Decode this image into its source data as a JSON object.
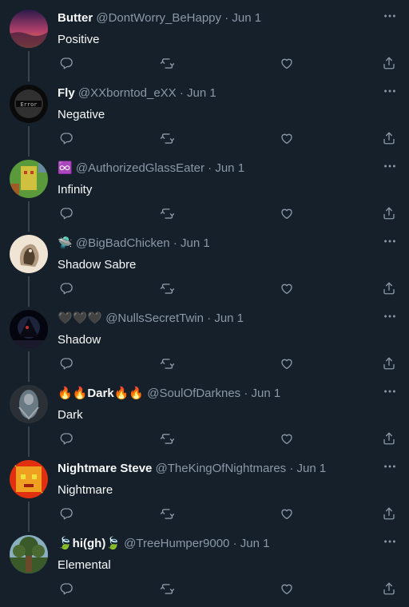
{
  "tweets": [
    {
      "name": "Butter",
      "handle": "@DontWorry_BeHappy",
      "sep": "·",
      "date": "Jun 1",
      "text": "Positive",
      "avatar": {
        "icon": "sunset-avatar",
        "colors": [
          "#2a1a4a",
          "#b0406a",
          "#f08040"
        ]
      }
    },
    {
      "name": "Fly",
      "handle": "@XXborntod_eXX",
      "sep": "·",
      "date": "Jun 1",
      "text": "Negative",
      "avatar": {
        "icon": "error-avatar",
        "colors": [
          "#0a0a0a",
          "#555555",
          "#bbbbbb"
        ]
      }
    },
    {
      "name": "♾️",
      "handle": "@AuthorizedGlassEater",
      "sep": "·",
      "date": "Jun 1",
      "text": "Infinity",
      "avatar": {
        "icon": "pixel-avatar",
        "colors": [
          "#5a9a3a",
          "#d0c040",
          "#c04020"
        ]
      }
    },
    {
      "name": "🛸",
      "handle": "@BigBadChicken",
      "sep": "·",
      "date": "Jun 1",
      "text": "Shadow Sabre",
      "avatar": {
        "icon": "chicken-avatar",
        "colors": [
          "#f0e4d4",
          "#3a2a1a",
          "#8a6a4a"
        ]
      }
    },
    {
      "name": "🖤🖤🖤",
      "handle": "@NullsSecretTwin",
      "sep": "·",
      "date": "Jun 1",
      "text": "Shadow",
      "avatar": {
        "icon": "shadow-avatar",
        "colors": [
          "#050510",
          "#2a3050",
          "#c03030"
        ]
      }
    },
    {
      "name": "🔥🔥Dark🔥🔥",
      "handle": "@SoulOfDarknes",
      "sep": "·",
      "date": "Jun 1",
      "text": "Dark",
      "avatar": {
        "icon": "dark-figure-avatar",
        "colors": [
          "#2a3036",
          "#6a7a84",
          "#a0aab0"
        ]
      }
    },
    {
      "name": "Nightmare Steve",
      "handle": "@TheKingOfNightmares",
      "sep": "·",
      "date": "Jun 1",
      "text": "Nightmare",
      "avatar": {
        "icon": "fire-steve-avatar",
        "colors": [
          "#e03010",
          "#f0a020",
          "#f0e040"
        ]
      }
    },
    {
      "name": "🍃hi(gh)🍃",
      "handle": "@TreeHumper9000",
      "sep": "·",
      "date": "Jun 1",
      "text": "Elemental",
      "avatar": {
        "icon": "tree-avatar",
        "colors": [
          "#3a5a2a",
          "#8ab0c0",
          "#6a4a2a"
        ]
      }
    }
  ],
  "colors": {
    "background": "#15202b",
    "secondary_text": "#8b98a5",
    "thread_line": "#38444d"
  },
  "action_icons": [
    "reply-icon",
    "retweet-icon",
    "like-icon",
    "share-icon"
  ]
}
